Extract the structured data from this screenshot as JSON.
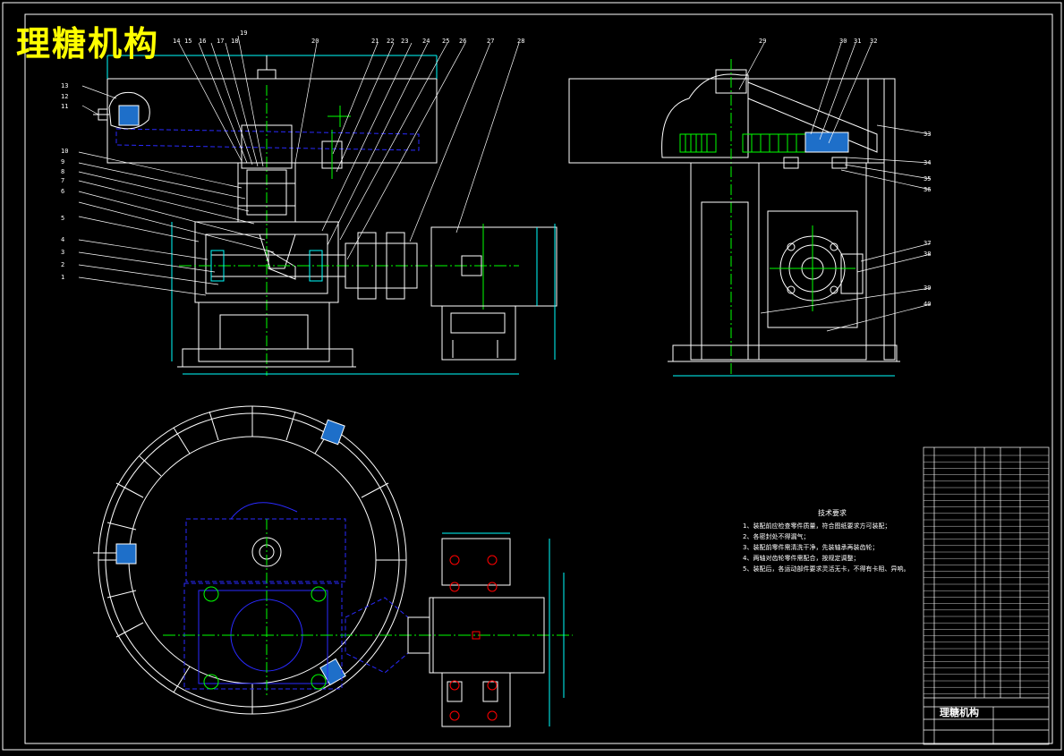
{
  "drawing": {
    "title": "理糖机构",
    "title_block_name": "理糖机构",
    "part_balloons_top": [
      "14",
      "15",
      "16",
      "17",
      "18",
      "19",
      "20",
      "21",
      "22",
      "23",
      "24",
      "25",
      "26",
      "27",
      "28"
    ],
    "part_balloons_left": [
      "13",
      "12",
      "11",
      "10",
      "9",
      "8",
      "7",
      "6",
      "5",
      "4",
      "3",
      "2",
      "1"
    ],
    "part_balloons_side": [
      "29",
      "30",
      "31",
      "32",
      "33",
      "34",
      "35",
      "36",
      "37",
      "38",
      "39",
      "40"
    ]
  },
  "tech_requirements": {
    "heading": "技术要求",
    "items": [
      "1、装配前应检查零件质量，符合图纸要求方可装配；",
      "2、各密封处不得漏气；",
      "3、装配前零件需清洗干净，先装轴承再装齿轮；",
      "4、两轴对齿轮零件需配合，按规定调整；",
      "5、装配后，各运动部件要求灵活无卡，不得有卡阻、异响。"
    ]
  },
  "colors": {
    "background": "#000000",
    "outline": "#ffffff",
    "hidden": "#2a2aff",
    "center": "#00ff00",
    "dimension": "#00ffff",
    "accent": "#ff0000",
    "title": "#ffff00"
  }
}
